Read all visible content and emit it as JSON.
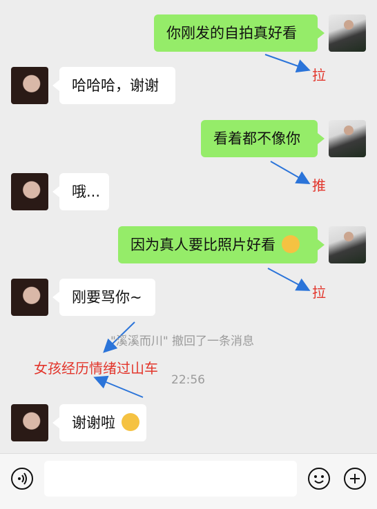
{
  "messages": [
    {
      "side": "right",
      "text": "你刚发的自拍真好看"
    },
    {
      "side": "left",
      "text": "哈哈哈，谢谢"
    },
    {
      "side": "right",
      "text": "看着都不像你"
    },
    {
      "side": "left",
      "text": "哦..."
    },
    {
      "side": "right",
      "text": "因为真人要比照片好看"
    },
    {
      "side": "left",
      "text": "刚要骂你~"
    },
    {
      "side": "left",
      "text": "谢谢啦"
    }
  ],
  "annotations": {
    "a1": "拉",
    "a2": "推",
    "a3": "拉",
    "a4": "女孩经历情绪过山车"
  },
  "system": {
    "recall": "\"溪溪而川\" 撤回了一条消息",
    "time": "22:56"
  },
  "icons": {
    "voice": "voice-toggle-icon",
    "emoji": "emoji-icon",
    "plus": "plus-icon"
  },
  "colors": {
    "bubble_right": "#95ec69",
    "bubble_left": "#ffffff",
    "annotation": "#e2352b",
    "background": "#ededed"
  }
}
